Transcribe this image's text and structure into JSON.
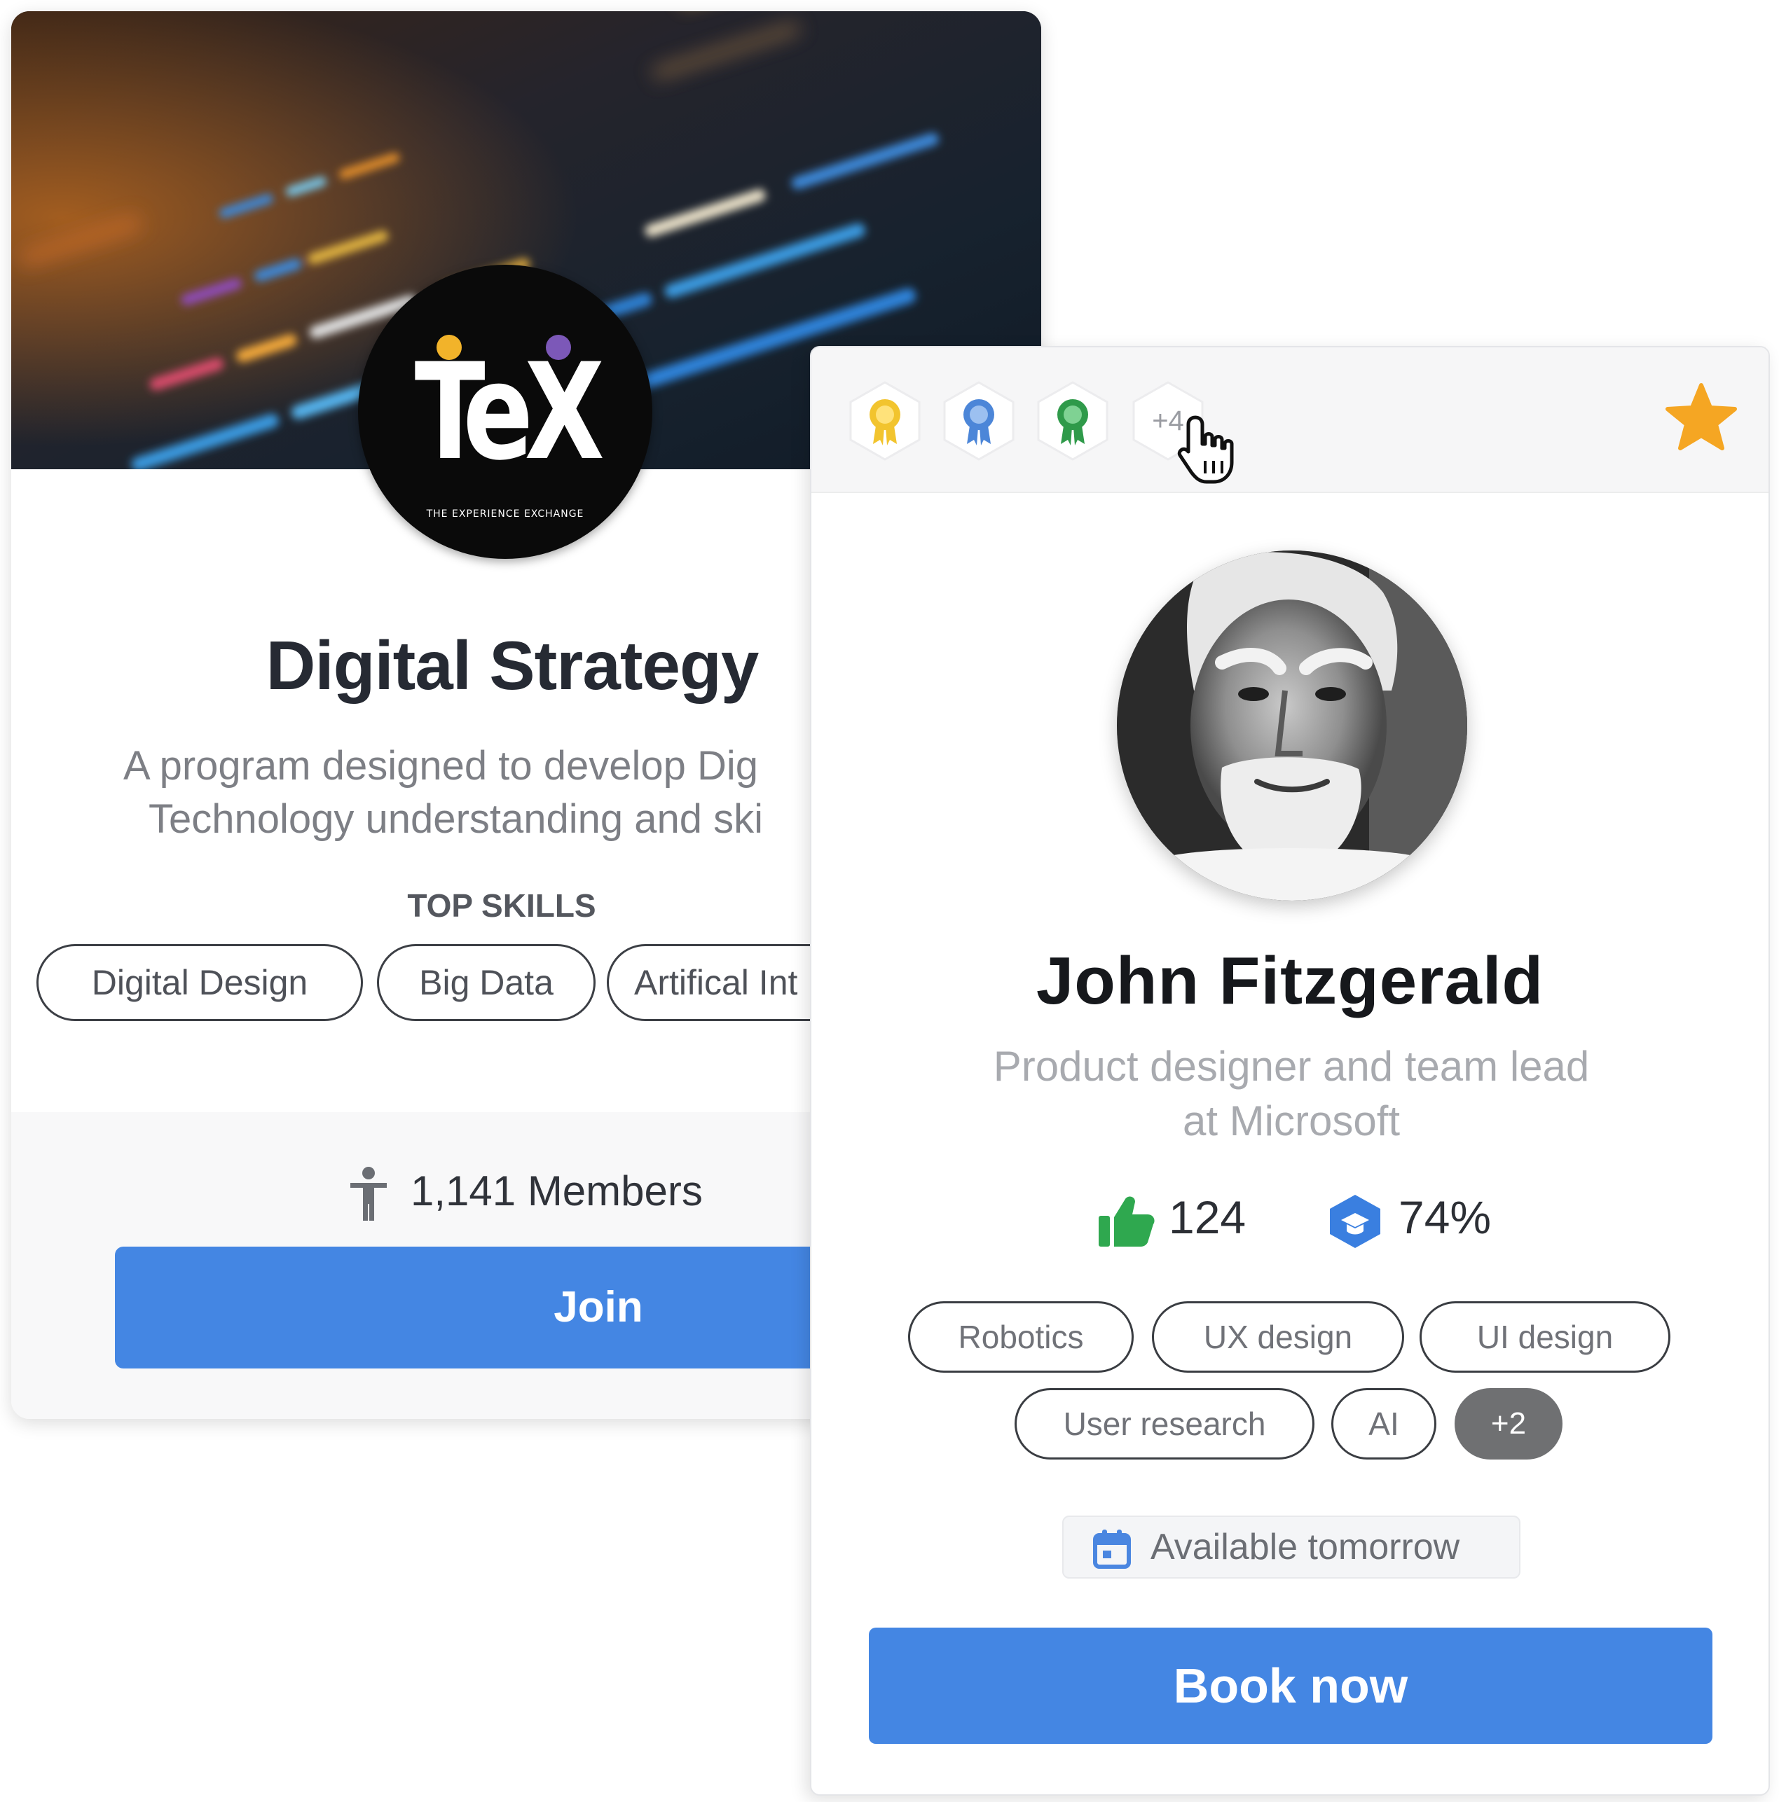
{
  "program_card": {
    "logo_text": "TeX",
    "logo_subtitle": "THE EXPERIENCE EXCHANGE",
    "title": "Digital Strategy",
    "description_line1": "A program designed to develop  Dig",
    "description_line2": "Technology understanding and ski",
    "top_skills_label": "TOP SKILLS",
    "skills": [
      "Digital Design",
      "Big Data",
      "Artifical Int"
    ],
    "members_label": "1,141 Members",
    "join_label": "Join"
  },
  "mentor_card": {
    "badges": [
      {
        "icon": "gold-award-icon",
        "color": "#f2c42e"
      },
      {
        "icon": "blue-award-icon",
        "color": "#4c86d8"
      },
      {
        "icon": "green-award-icon",
        "color": "#2f9a4a"
      }
    ],
    "more_badges_label": "+4",
    "favorite_color": "#f5a623",
    "name": "John Fitzgerald",
    "role_line1": "Product designer and team lead",
    "role_line2": "at Microsoft",
    "likes_count": "124",
    "score_percent": "74%",
    "skills": [
      "Robotics",
      "UX design",
      "UI design",
      "User research",
      "AI"
    ],
    "more_skills_label": "+2",
    "availability_label": "Available tomorrow",
    "book_label": "Book now"
  },
  "colors": {
    "primary_button": "#4486e3",
    "like_icon": "#2fa84f",
    "score_icon": "#3a7fe0"
  }
}
